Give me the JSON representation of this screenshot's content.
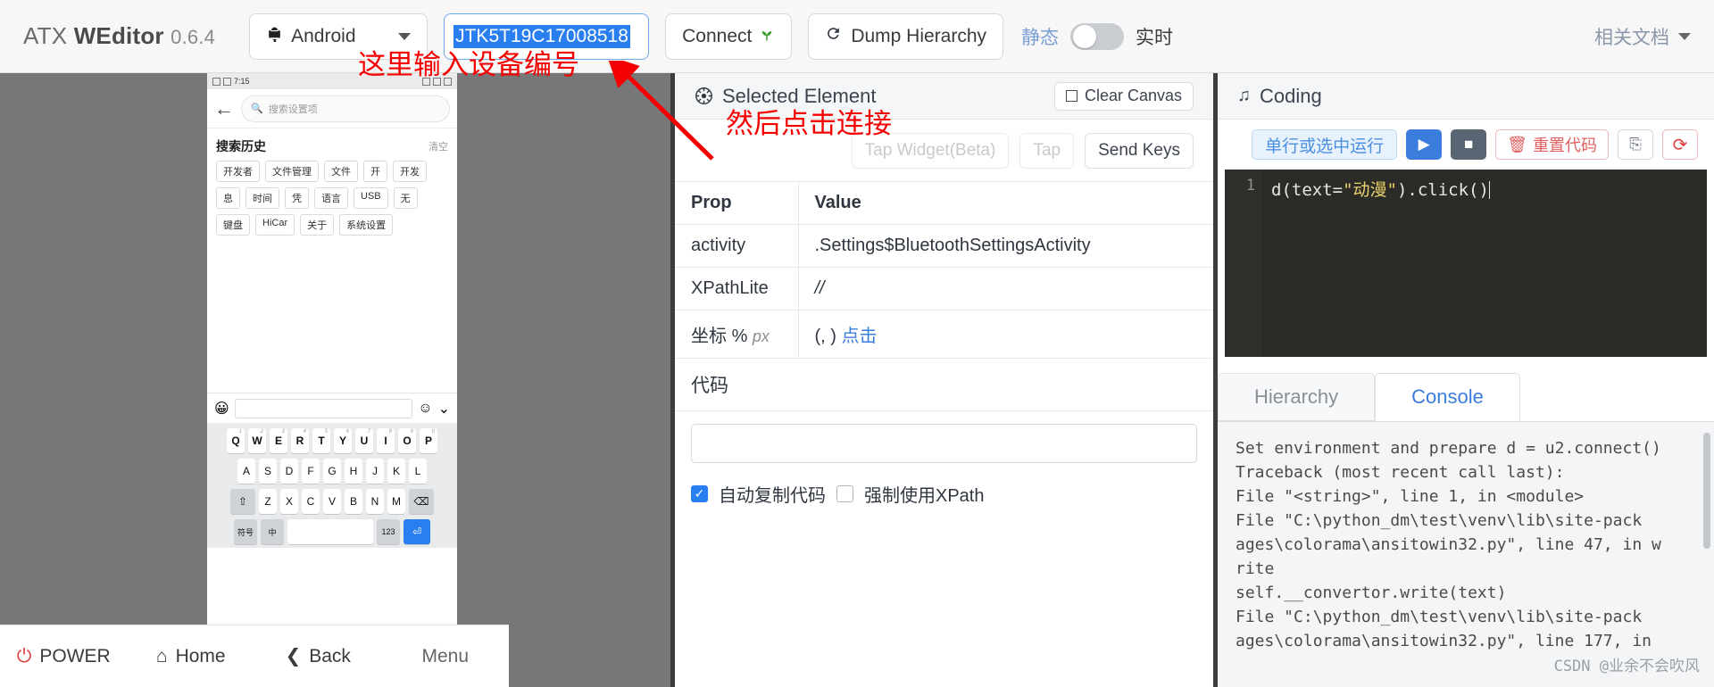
{
  "header": {
    "brand_atx": "ATX",
    "brand_weditor": "WEditor",
    "brand_version": "0.6.4",
    "platform": "Android",
    "platform_icon": "android-icon",
    "serial_value": "JTK5T19C17008518",
    "connect_label": "Connect",
    "connect_icon": "seedling-icon",
    "dump_label": "Dump Hierarchy",
    "dump_icon": "refresh-icon",
    "toggle_left_label": "静态",
    "toggle_right_label": "实时",
    "toggle_state": "off",
    "docs_label": "相关文档",
    "docs_caret": "chevron-down-icon"
  },
  "annotations": [
    {
      "text": "这里输入设备编号",
      "color": "#f50000"
    },
    {
      "text": "然后点击连接",
      "color": "#f50000"
    }
  ],
  "device": {
    "status_bar": {
      "time": "7:15",
      "badges": "signal-wifi-battery"
    },
    "back_icon": "back-arrow-icon",
    "search_placeholder": "搜索设置项",
    "search_icon": "search-icon",
    "history_title": "搜索历史",
    "history_clear": "清空",
    "chips": [
      "开发者",
      "文件管理",
      "文件",
      "开",
      "开发",
      "息",
      "时间",
      "凭",
      "语言",
      "USB",
      "无",
      "键盘",
      "HiCar",
      "关于",
      "系统设置"
    ],
    "ime": {
      "mic_icon": "sticker-icon",
      "emoji_icon": "emoji-icon",
      "collapse_icon": "chevron-down-icon"
    },
    "keyboard": {
      "row1": [
        "Q",
        "W",
        "E",
        "R",
        "T",
        "Y",
        "U",
        "I",
        "O",
        "P"
      ],
      "row1_sup": [
        "1",
        "2",
        "3",
        "4",
        "5",
        "6",
        "7",
        "8",
        "9",
        "0"
      ],
      "row2": [
        "A",
        "S",
        "D",
        "F",
        "G",
        "H",
        "J",
        "K",
        "L"
      ],
      "row3_left": "shift-icon",
      "row3": [
        "Z",
        "X",
        "C",
        "V",
        "B",
        "N",
        "M"
      ],
      "row3_right": "backspace-icon",
      "row4": [
        "符号",
        "中",
        "空格",
        "123",
        "enter-icon"
      ]
    },
    "navbar": [
      {
        "label": "POWER",
        "icon": "power-icon"
      },
      {
        "label": "Home",
        "icon": "home-icon"
      },
      {
        "label": "Back",
        "icon": "back-chevron-icon"
      },
      {
        "label": "Menu",
        "icon": "menu-icon"
      }
    ]
  },
  "selected_element": {
    "title": "Selected Element",
    "title_icon": "gear-icon",
    "clear_canvas_label": "Clear Canvas",
    "clear_canvas_icon": "square-icon",
    "actions": [
      {
        "label": "Tap Widget(Beta)",
        "state": "disabled"
      },
      {
        "label": "Tap",
        "state": "disabled"
      },
      {
        "label": "Send Keys",
        "state": "enabled"
      }
    ],
    "table": {
      "headers": [
        "Prop",
        "Value"
      ],
      "rows": [
        {
          "prop": "activity",
          "value": ".Settings$BluetoothSettingsActivity"
        },
        {
          "prop": "XPathLite",
          "value": "//"
        },
        {
          "prop_main": "坐标",
          "prop_pct": "%",
          "prop_px": "px",
          "value": "(, )",
          "value_link": "点击"
        }
      ]
    },
    "code_label": "代码",
    "code_value": "",
    "checkboxes": [
      {
        "label": "自动复制代码",
        "checked": true
      },
      {
        "label": "强制使用XPath",
        "checked": false
      }
    ]
  },
  "coding": {
    "title": "Coding",
    "title_icon": "music-note-icon",
    "tooltip": "单行或选中运行",
    "buttons": [
      {
        "name": "run",
        "icon": "play-icon"
      },
      {
        "name": "stop",
        "icon": "stop-icon"
      },
      {
        "name": "reset",
        "icon": "trash-icon",
        "label": "重置代码"
      },
      {
        "name": "copy",
        "icon": "copy-icon"
      },
      {
        "name": "refresh",
        "icon": "reload-icon"
      }
    ],
    "editor": {
      "line_number": "1",
      "code_prefix": "d(text=",
      "code_string": "\"动漫\"",
      "code_suffix": ").click()"
    },
    "tabs": [
      {
        "label": "Hierarchy",
        "active": false
      },
      {
        "label": "Console",
        "active": true
      }
    ],
    "console_lines": [
      "Set environment and prepare d = u2.connect()",
      "Traceback (most recent call last):",
      "  File \"<string>\", line 1, in <module>",
      "  File \"C:\\python_dm\\test\\venv\\lib\\site-pack",
      "ages\\colorama\\ansitowin32.py\", line 47, in w",
      "rite",
      "    self.__convertor.write(text)",
      "  File \"C:\\python_dm\\test\\venv\\lib\\site-pack",
      "ages\\colorama\\ansitowin32.py\", line 177, in"
    ],
    "watermark": "CSDN @业余不会吹风"
  }
}
